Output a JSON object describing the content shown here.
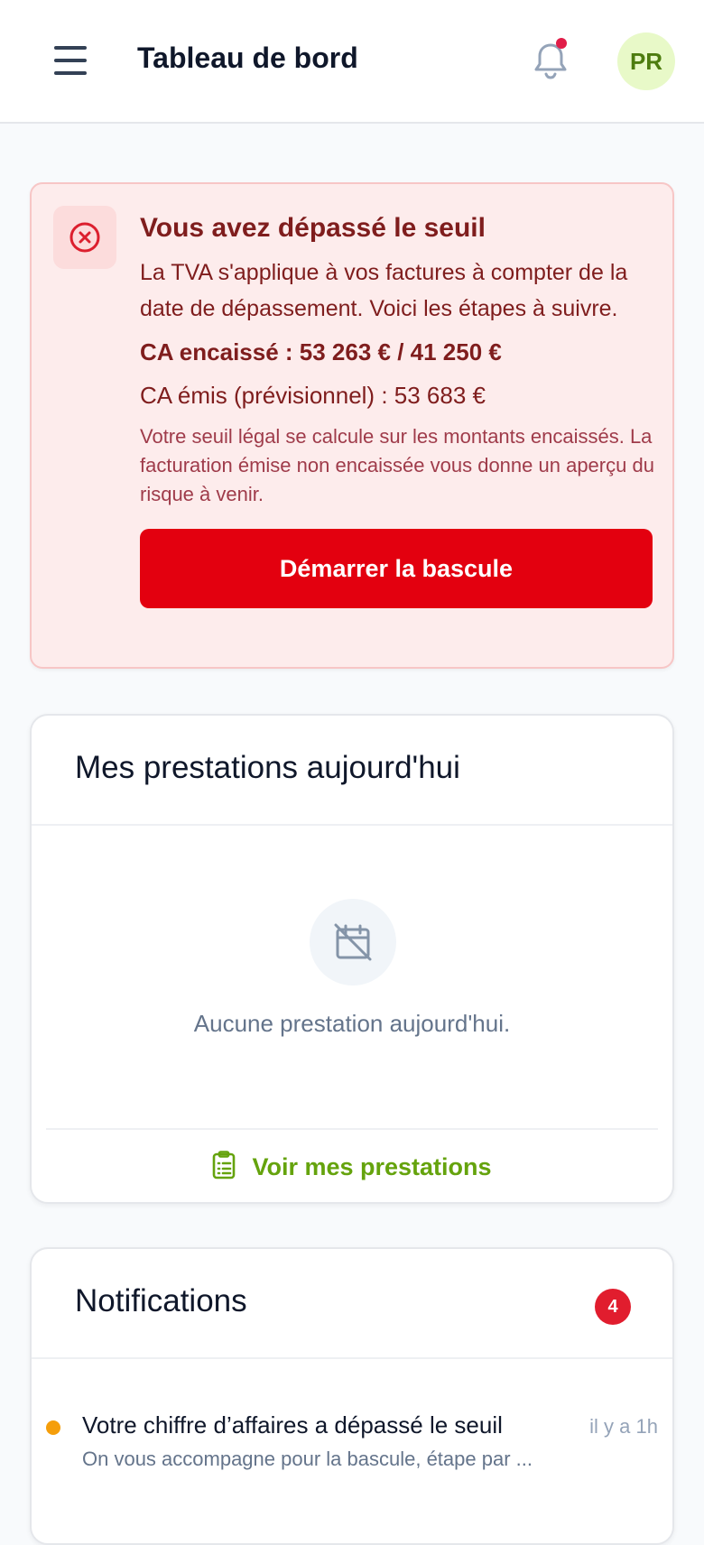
{
  "header": {
    "title": "Tableau de bord",
    "avatar_initials": "PR",
    "has_unread": true
  },
  "alert": {
    "title": "Vous avez dépassé le seuil",
    "text": "La TVA s'applique à vos factures à compter de la date de dépassement. Voici les étapes à suivre.",
    "ca_encaisse": "CA encaissé : 53 263 € / 41 250 €",
    "ca_emis": "CA émis (prévisionnel) : 53 683 €",
    "note": "Votre seuil légal se calcule sur les montants encaissés. La facturation émise non encaissée vous donne un aperçu du risque à venir.",
    "button_label": "Démarrer la bascule",
    "icon": "x-circle-icon",
    "color": "#e3000f"
  },
  "prestations": {
    "title": "Mes prestations aujourd'hui",
    "empty_icon": "calendar-off-icon",
    "empty_text": "Aucune prestation aujourd'hui.",
    "link_icon": "clipboard-list-icon",
    "link_label": "Voir mes prestations",
    "accent": "#65a30d"
  },
  "notifications": {
    "title": "Notifications",
    "count": "4",
    "items": [
      {
        "title": "Votre chiffre d’affaires a dépassé le seuil",
        "time": "il y a 1h",
        "subtitle": "On vous accompagne pour la bascule, étape par ...",
        "dot_color": "#f59e0b"
      }
    ]
  }
}
